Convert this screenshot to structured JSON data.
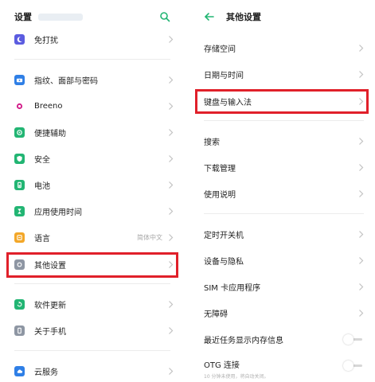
{
  "left": {
    "title": "设置",
    "items": [
      {
        "label": "免打扰",
        "icon": "moon-icon",
        "color": "#5b5ce0"
      },
      {
        "label": "指纹、面部与密码",
        "icon": "fingerprint-icon",
        "color": "#2f7fe6"
      },
      {
        "label": "Breeno",
        "icon": "breeno-icon",
        "color": "#d3208b"
      },
      {
        "label": "便捷辅助",
        "icon": "assist-icon",
        "color": "#22b573"
      },
      {
        "label": "安全",
        "icon": "shield-icon",
        "color": "#22b573"
      },
      {
        "label": "电池",
        "icon": "battery-icon",
        "color": "#22b573"
      },
      {
        "label": "应用使用时间",
        "icon": "hourglass-icon",
        "color": "#22b573"
      },
      {
        "label": "语言",
        "value": "简体中文",
        "icon": "language-icon",
        "color": "#f3a728"
      },
      {
        "label": "其他设置",
        "icon": "other-settings-icon",
        "color": "#8e96a3"
      },
      {
        "label": "软件更新",
        "icon": "update-icon",
        "color": "#22b573"
      },
      {
        "label": "关于手机",
        "icon": "phone-info-icon",
        "color": "#8e96a3"
      },
      {
        "label": "云服务",
        "icon": "cloud-icon",
        "color": "#2f7fe6"
      }
    ]
  },
  "right": {
    "title": "其他设置",
    "items": [
      {
        "label": "存储空间"
      },
      {
        "label": "日期与时间"
      },
      {
        "label": "键盘与输入法"
      },
      {
        "label": "搜索"
      },
      {
        "label": "下载管理"
      },
      {
        "label": "使用说明"
      },
      {
        "label": "定时开关机"
      },
      {
        "label": "设备与隐私"
      },
      {
        "label": "SIM 卡应用程序"
      },
      {
        "label": "无障碍"
      },
      {
        "label": "最近任务显示内存信息"
      },
      {
        "label": "OTG 连接",
        "sub": "10 分钟未使用，将自动关闭。"
      }
    ]
  },
  "colors": {
    "highlight": "#e0202a",
    "accent": "#22b573"
  }
}
